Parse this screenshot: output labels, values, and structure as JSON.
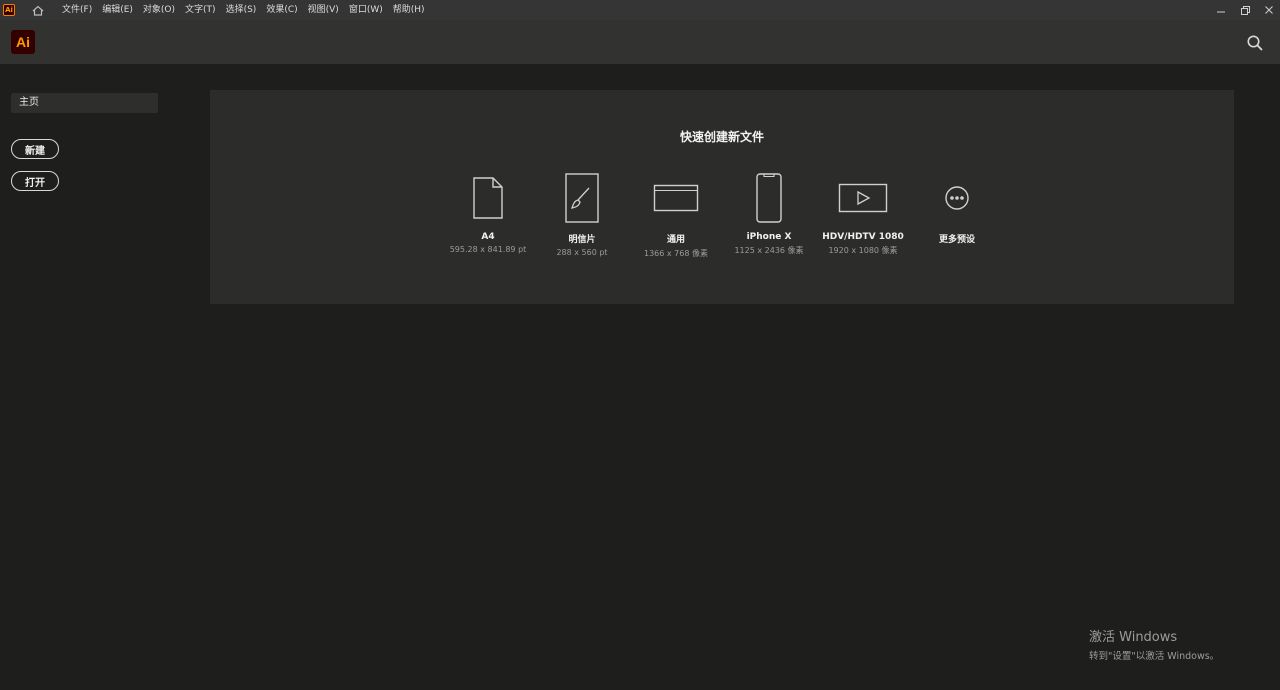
{
  "menubar": {
    "app_icon_label": "Ai",
    "items": [
      "文件(F)",
      "编辑(E)",
      "对象(O)",
      "文字(T)",
      "选择(S)",
      "效果(C)",
      "视图(V)",
      "窗口(W)",
      "帮助(H)"
    ]
  },
  "header": {
    "logo": "Ai"
  },
  "sidebar": {
    "home": "主页",
    "new_label": "新建",
    "open_label": "打开"
  },
  "quick": {
    "title": "快速创建新文件",
    "presets": [
      {
        "name": "A4",
        "size": "595.28 x 841.89 pt",
        "icon": "document-icon"
      },
      {
        "name": "明信片",
        "size": "288 x 560 pt",
        "icon": "brush-icon"
      },
      {
        "name": "通用",
        "size": "1366 x 768 像素",
        "icon": "web-window-icon"
      },
      {
        "name": "iPhone X",
        "size": "1125 x 2436 像素",
        "icon": "phone-icon"
      },
      {
        "name": "HDV/HDTV 1080",
        "size": "1920 x 1080 像素",
        "icon": "video-play-icon"
      },
      {
        "name": "更多预设",
        "size": "",
        "icon": "more-icon"
      }
    ]
  },
  "watermark": {
    "title": "激活 Windows",
    "subtitle": "转到\"设置\"以激活 Windows。"
  },
  "colors": {
    "background": "#1e1f1d",
    "menubar": "#353535",
    "header": "#323331",
    "panel": "#2c2d2b",
    "ai_brand_bg": "#330000",
    "ai_brand_fg": "#ff9a00"
  }
}
